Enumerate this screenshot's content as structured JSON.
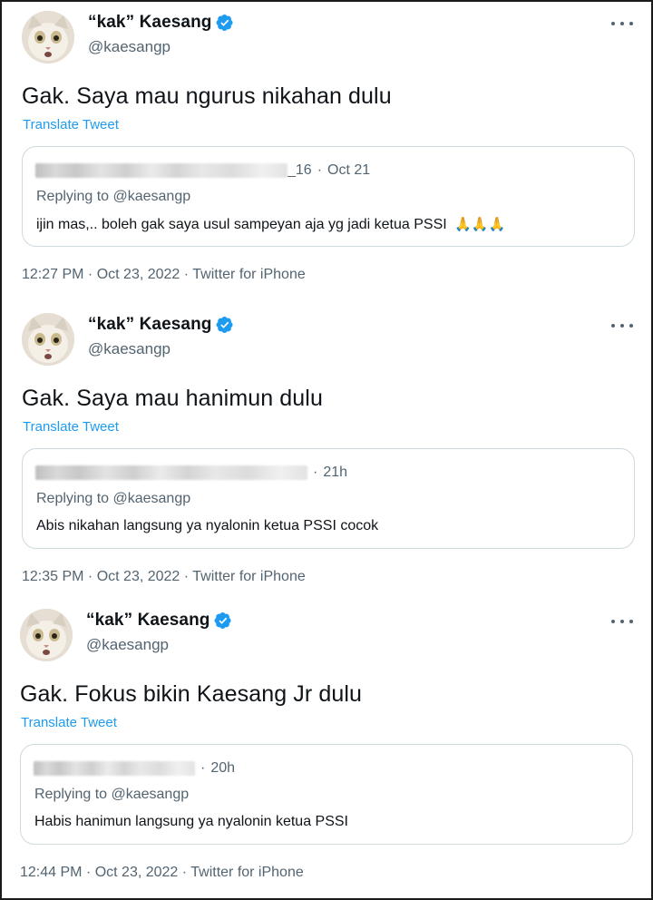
{
  "tweets": [
    {
      "display_name": "“kak” Kaesang",
      "handle": "@kaesangp",
      "text": "Gak. Saya mau ngurus nikahan dulu",
      "translate_label": "Translate Tweet",
      "quote": {
        "handle_suffix": "_16",
        "time": "Oct 21",
        "replying": "Replying to @kaesangp",
        "body": "ijin mas,.. boleh gak saya usul sampeyan aja yg jadi ketua PSSI",
        "emoji": "🙏🙏🙏"
      },
      "meta": "12:27 PM · Oct 23, 2022 · Twitter for iPhone"
    },
    {
      "display_name": "“kak” Kaesang",
      "handle": "@kaesangp",
      "text": "Gak. Saya mau hanimun dulu",
      "translate_label": "Translate Tweet",
      "quote": {
        "handle_suffix": "",
        "time": "21h",
        "replying": "Replying to @kaesangp",
        "body": "Abis nikahan langsung ya nyalonin ketua PSSI cocok",
        "emoji": ""
      },
      "meta": "12:35 PM · Oct 23, 2022 · Twitter for iPhone"
    },
    {
      "display_name": "“kak” Kaesang",
      "handle": "@kaesangp",
      "text": "Gak. Fokus bikin Kaesang Jr dulu",
      "translate_label": "Translate Tweet",
      "quote": {
        "handle_suffix": "",
        "time": "20h",
        "replying": "Replying to @kaesangp",
        "body": "Habis hanimun langsung ya nyalonin ketua PSSI",
        "emoji": ""
      },
      "meta": "12:44 PM · Oct 23, 2022 · Twitter for iPhone"
    }
  ],
  "icons": {
    "verified": "verified-badge-icon",
    "more": "more-horizontal-icon"
  },
  "colors": {
    "link": "#1d9bf0",
    "secondary_text": "#536471",
    "verified": "#1d9bf0",
    "border": "#cfd9de"
  }
}
